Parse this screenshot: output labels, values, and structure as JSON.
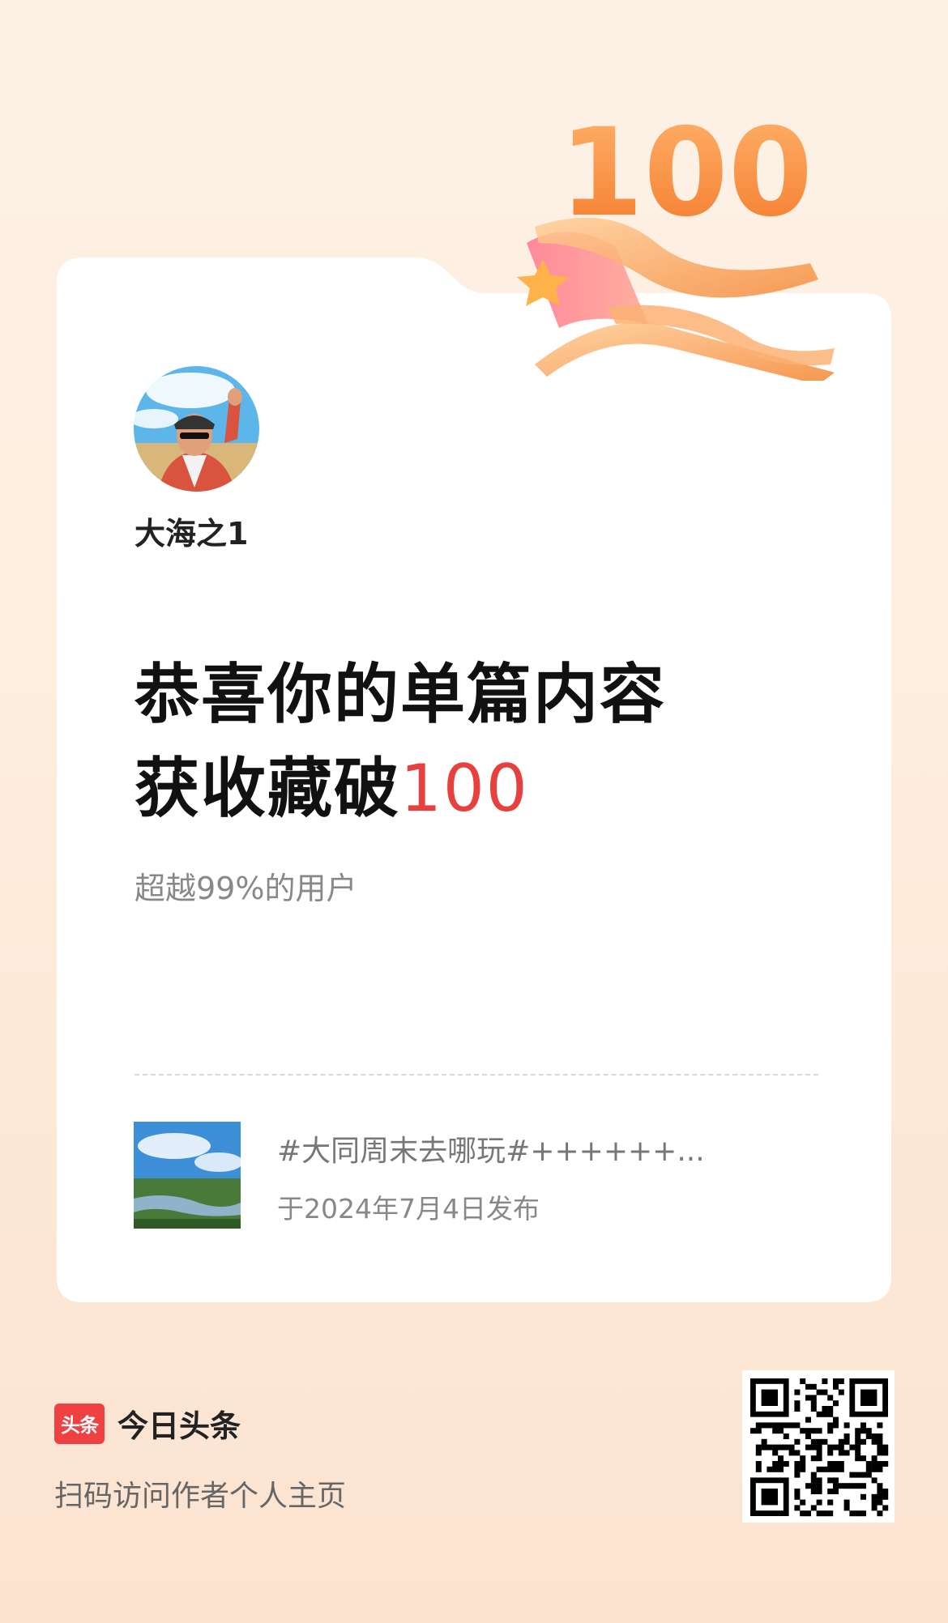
{
  "user": {
    "name": "大海之1"
  },
  "headline": {
    "line1": "恭喜你的单篇内容",
    "line2_prefix": "获收藏破",
    "count": "100"
  },
  "badge": {
    "number": "100"
  },
  "subtitle": "超越99%的用户",
  "article": {
    "title": "#大同周末去哪玩#++++++...",
    "date": "于2024年7月4日发布"
  },
  "brand": {
    "logo_text": "头条",
    "name": "今日头条",
    "cta": "扫码访问作者个人主页"
  },
  "colors": {
    "accent": "#e8413d",
    "brand_red": "#f04142",
    "badge_orange": "#f7923a"
  },
  "icons": {
    "trophy": "100-milestone-badge-icon",
    "qr": "qr-code-icon"
  }
}
